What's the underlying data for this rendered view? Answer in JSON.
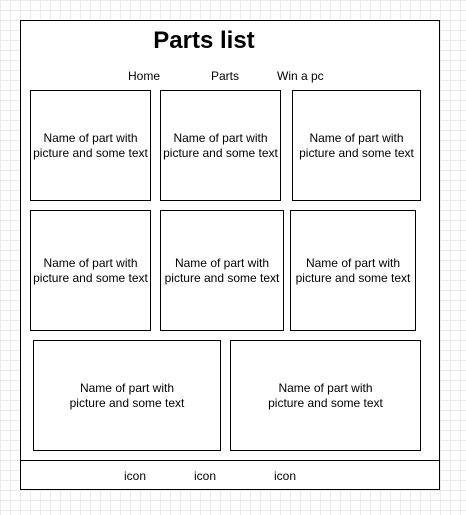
{
  "header": {
    "title": "Parts list"
  },
  "nav": {
    "items": [
      {
        "label": "Home"
      },
      {
        "label": "Parts"
      },
      {
        "label": "Win a pc"
      }
    ]
  },
  "cards": [
    {
      "line1": "Name of part with",
      "line2": "picture and some text"
    },
    {
      "line1": "Name of part with",
      "line2": "picture and some text"
    },
    {
      "line1": "Name of part with",
      "line2": "picture and some text"
    },
    {
      "line1": "Name of part with",
      "line2": "picture and some text"
    },
    {
      "line1": "Name of part with",
      "line2": "picture and some text"
    },
    {
      "line1": "Name of part with",
      "line2": "picture and some text"
    },
    {
      "line1": "Name of part with",
      "line2": "picture and some text"
    },
    {
      "line1": "Name of part with",
      "line2": "picture and some text"
    }
  ],
  "footer": {
    "icons": [
      {
        "label": "icon"
      },
      {
        "label": "icon"
      },
      {
        "label": "icon"
      }
    ]
  }
}
